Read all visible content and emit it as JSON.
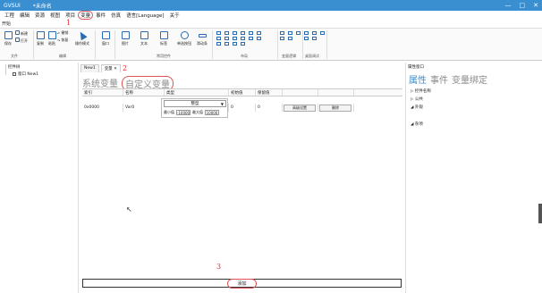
{
  "window": {
    "app": "GVSUI",
    "doc": "*未命名",
    "controls": [
      "—",
      "□",
      "✕"
    ]
  },
  "menu": [
    "工程",
    "编辑",
    "资源",
    "视图",
    "项目",
    "变量",
    "事件",
    "仿真",
    "语言[Language]",
    "关于"
  ],
  "annotations": {
    "one": "1",
    "two": "2",
    "three": "3"
  },
  "ribbon": {
    "tab": "开始",
    "buttons": {
      "save": "保存",
      "new": "新建",
      "open": "打开",
      "copy": "复制",
      "paste": "粘贴",
      "undo": "撤销",
      "redo": "恢复",
      "operate": "操作模式",
      "window": "窗口",
      "image": "图片",
      "text": "文本",
      "label": "标签",
      "single": "单选按钮",
      "slide": "滑动条"
    },
    "groups": {
      "file": "文件",
      "edit": "编辑",
      "common": "常用控件",
      "layout": "布局",
      "logic": "变量逻辑",
      "debug": "桌面调试"
    }
  },
  "left_panel": {
    "header": "控件树",
    "node": "窗口 New1"
  },
  "center": {
    "tabs": [
      "New1",
      "变量 ✕"
    ],
    "subtabs": {
      "system": "系统变量",
      "custom": "自定义变量"
    },
    "columns": [
      "索引",
      "名称",
      "类型",
      "初始值",
      "保留值",
      "",
      ""
    ],
    "row": {
      "index": "0x0000",
      "name": "Var0",
      "init": "0",
      "retain": "0",
      "advanced": "高级设置",
      "delete": "删除"
    },
    "popup": {
      "type": "整型",
      "min_label": "最小值",
      "min": "-10000",
      "max_label": "最大值",
      "max": "10000"
    },
    "add_button": "添加"
  },
  "right_panel": {
    "header": "属性窗口",
    "tabs": {
      "props": "属性",
      "events": "事件",
      "binding": "变量绑定"
    },
    "items": {
      "name": "▷ 控件名称",
      "common": "▷ 公共",
      "appearance": "◢ 外观",
      "other": "◢ 杂项"
    }
  }
}
